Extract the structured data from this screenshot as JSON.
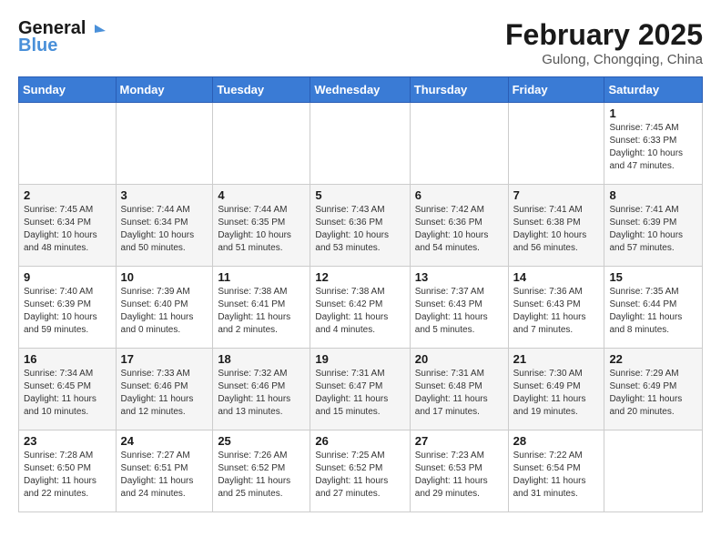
{
  "header": {
    "logo_line1": "General",
    "logo_line2": "Blue",
    "month": "February 2025",
    "location": "Gulong, Chongqing, China"
  },
  "weekdays": [
    "Sunday",
    "Monday",
    "Tuesday",
    "Wednesday",
    "Thursday",
    "Friday",
    "Saturday"
  ],
  "weeks": [
    [
      {
        "day": "",
        "info": ""
      },
      {
        "day": "",
        "info": ""
      },
      {
        "day": "",
        "info": ""
      },
      {
        "day": "",
        "info": ""
      },
      {
        "day": "",
        "info": ""
      },
      {
        "day": "",
        "info": ""
      },
      {
        "day": "1",
        "info": "Sunrise: 7:45 AM\nSunset: 6:33 PM\nDaylight: 10 hours and 47 minutes."
      }
    ],
    [
      {
        "day": "2",
        "info": "Sunrise: 7:45 AM\nSunset: 6:34 PM\nDaylight: 10 hours and 48 minutes."
      },
      {
        "day": "3",
        "info": "Sunrise: 7:44 AM\nSunset: 6:34 PM\nDaylight: 10 hours and 50 minutes."
      },
      {
        "day": "4",
        "info": "Sunrise: 7:44 AM\nSunset: 6:35 PM\nDaylight: 10 hours and 51 minutes."
      },
      {
        "day": "5",
        "info": "Sunrise: 7:43 AM\nSunset: 6:36 PM\nDaylight: 10 hours and 53 minutes."
      },
      {
        "day": "6",
        "info": "Sunrise: 7:42 AM\nSunset: 6:36 PM\nDaylight: 10 hours and 54 minutes."
      },
      {
        "day": "7",
        "info": "Sunrise: 7:41 AM\nSunset: 6:38 PM\nDaylight: 10 hours and 56 minutes."
      },
      {
        "day": "8",
        "info": "Sunrise: 7:41 AM\nSunset: 6:39 PM\nDaylight: 10 hours and 57 minutes."
      }
    ],
    [
      {
        "day": "9",
        "info": "Sunrise: 7:40 AM\nSunset: 6:39 PM\nDaylight: 10 hours and 59 minutes."
      },
      {
        "day": "10",
        "info": "Sunrise: 7:39 AM\nSunset: 6:40 PM\nDaylight: 11 hours and 0 minutes."
      },
      {
        "day": "11",
        "info": "Sunrise: 7:38 AM\nSunset: 6:41 PM\nDaylight: 11 hours and 2 minutes."
      },
      {
        "day": "12",
        "info": "Sunrise: 7:38 AM\nSunset: 6:42 PM\nDaylight: 11 hours and 4 minutes."
      },
      {
        "day": "13",
        "info": "Sunrise: 7:37 AM\nSunset: 6:43 PM\nDaylight: 11 hours and 5 minutes."
      },
      {
        "day": "14",
        "info": "Sunrise: 7:36 AM\nSunset: 6:43 PM\nDaylight: 11 hours and 7 minutes."
      },
      {
        "day": "15",
        "info": "Sunrise: 7:35 AM\nSunset: 6:44 PM\nDaylight: 11 hours and 8 minutes."
      }
    ],
    [
      {
        "day": "16",
        "info": "Sunrise: 7:34 AM\nSunset: 6:45 PM\nDaylight: 11 hours and 10 minutes."
      },
      {
        "day": "17",
        "info": "Sunrise: 7:33 AM\nSunset: 6:46 PM\nDaylight: 11 hours and 12 minutes."
      },
      {
        "day": "18",
        "info": "Sunrise: 7:32 AM\nSunset: 6:46 PM\nDaylight: 11 hours and 13 minutes."
      },
      {
        "day": "19",
        "info": "Sunrise: 7:31 AM\nSunset: 6:47 PM\nDaylight: 11 hours and 15 minutes."
      },
      {
        "day": "20",
        "info": "Sunrise: 7:31 AM\nSunset: 6:48 PM\nDaylight: 11 hours and 17 minutes."
      },
      {
        "day": "21",
        "info": "Sunrise: 7:30 AM\nSunset: 6:49 PM\nDaylight: 11 hours and 19 minutes."
      },
      {
        "day": "22",
        "info": "Sunrise: 7:29 AM\nSunset: 6:49 PM\nDaylight: 11 hours and 20 minutes."
      }
    ],
    [
      {
        "day": "23",
        "info": "Sunrise: 7:28 AM\nSunset: 6:50 PM\nDaylight: 11 hours and 22 minutes."
      },
      {
        "day": "24",
        "info": "Sunrise: 7:27 AM\nSunset: 6:51 PM\nDaylight: 11 hours and 24 minutes."
      },
      {
        "day": "25",
        "info": "Sunrise: 7:26 AM\nSunset: 6:52 PM\nDaylight: 11 hours and 25 minutes."
      },
      {
        "day": "26",
        "info": "Sunrise: 7:25 AM\nSunset: 6:52 PM\nDaylight: 11 hours and 27 minutes."
      },
      {
        "day": "27",
        "info": "Sunrise: 7:23 AM\nSunset: 6:53 PM\nDaylight: 11 hours and 29 minutes."
      },
      {
        "day": "28",
        "info": "Sunrise: 7:22 AM\nSunset: 6:54 PM\nDaylight: 11 hours and 31 minutes."
      },
      {
        "day": "",
        "info": ""
      }
    ]
  ]
}
